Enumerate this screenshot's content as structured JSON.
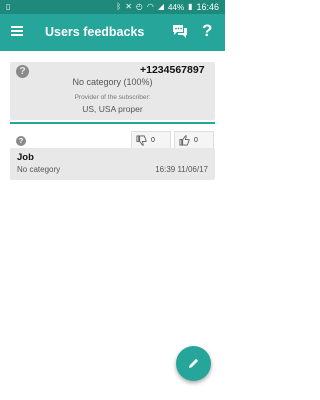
{
  "status_bar": {
    "battery": "44%",
    "time": "16:46"
  },
  "app_bar": {
    "title": "Users feedbacks",
    "menu_icon": "hamburger-menu-icon",
    "chat_icon": "chat-bubbles-icon",
    "help_icon": "question-mark-icon",
    "help_glyph": "?",
    "background": "#26a69a"
  },
  "subscriber_card": {
    "icon": "question-circle-icon",
    "icon_glyph": "?",
    "phone": "+1234567897",
    "category": "No category (100%)",
    "provider_label": "Provider of the subscriber:",
    "provider_value": "US, USA proper"
  },
  "feedback": {
    "icon_glyph": "?",
    "dislikes": "0",
    "likes": "0",
    "title": "Job",
    "category": "No category",
    "datetime": "16:39 11/06/17"
  },
  "fab": {
    "icon": "pencil-icon",
    "color": "#26a69a"
  }
}
